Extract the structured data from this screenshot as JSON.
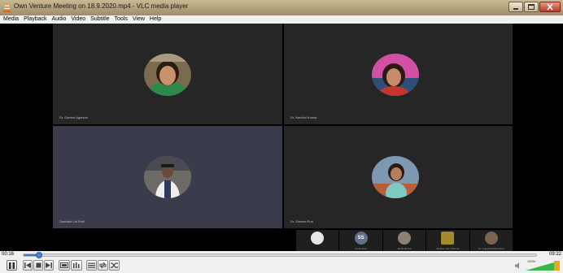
{
  "window": {
    "title": "Own Venture Meeting on 18.9.2020.mp4 - VLC media player",
    "icon": "vlc-cone-icon",
    "buttons": [
      "minimize",
      "maximize",
      "close"
    ]
  },
  "menu": [
    "Media",
    "Playback",
    "Audio",
    "Video",
    "Subtitle",
    "Tools",
    "View",
    "Help"
  ],
  "participants": [
    {
      "name": "Dr. Garima Agarwal"
    },
    {
      "name": "Dr. Nandini Kumar"
    },
    {
      "name": "Saurabh Lal Patil"
    },
    {
      "name": "Dr. Shweta Puri"
    }
  ],
  "strip": [
    {
      "name": "",
      "initials": ""
    },
    {
      "name": "Sruthi Ravi",
      "initials": "SS"
    },
    {
      "name": "Mohit Mehta",
      "initials": ""
    },
    {
      "name": "Shikhar Jain Sharma",
      "initials": ""
    },
    {
      "name": "Dr. Sugandha Bhandari",
      "initials": ""
    }
  ],
  "playback": {
    "elapsed": "00:16",
    "total": "09:22",
    "progress_fraction": 0.03,
    "volume_fraction": 1.0,
    "volume_label": "100%"
  },
  "controls": [
    "play-pause",
    "previous",
    "stop",
    "next",
    "fullscreen",
    "extended-settings",
    "playlist",
    "loop",
    "random"
  ],
  "colors": {
    "accent": "#3e79c9",
    "tile": "#262626",
    "tile_active": "#3a3c4b"
  }
}
